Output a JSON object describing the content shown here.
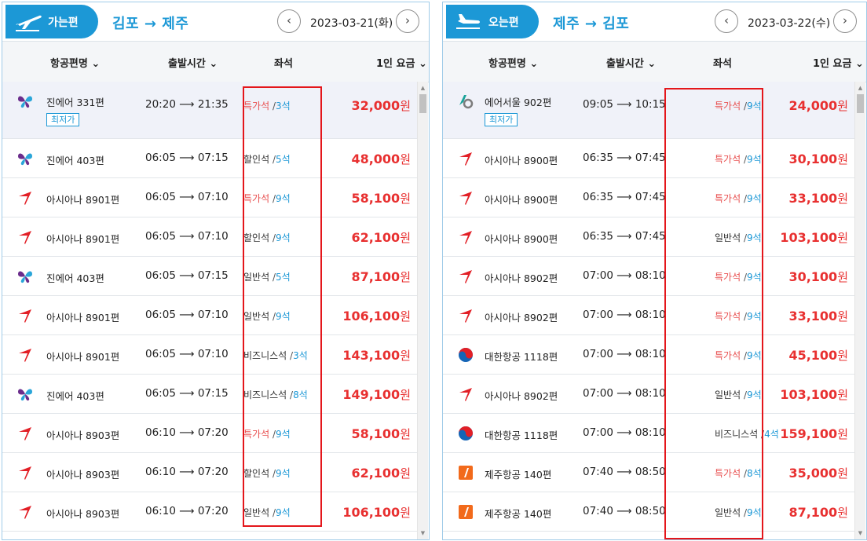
{
  "outbound": {
    "label": "가는편",
    "route": "김포 → 제주",
    "date": "2023-03-21(화)",
    "prev_btn": "‹",
    "next_btn": "›",
    "headers": {
      "airline": "항공편명 ⌄",
      "departure": "출발시간 ⌄",
      "seat": "좌석",
      "fare": "1인 요금 ⌄"
    },
    "flights": [
      {
        "logo": "jinair-butterfly-icon",
        "flight": "진에어 331편",
        "badge": "최저가",
        "dep": "20:20",
        "arr": "21:35",
        "class": "특가석",
        "seats": "3석",
        "price": "32,000",
        "unit": "원"
      },
      {
        "logo": "jinair-butterfly-icon",
        "flight": "진에어 403편",
        "dep": "06:05",
        "arr": "07:15",
        "class": "할인석",
        "seats": "5석",
        "price": "48,000",
        "unit": "원"
      },
      {
        "logo": "asiana-wing-icon",
        "flight": "아시아나 8901편",
        "dep": "06:05",
        "arr": "07:10",
        "class": "특가석",
        "seats": "9석",
        "price": "58,100",
        "unit": "원"
      },
      {
        "logo": "asiana-wing-icon",
        "flight": "아시아나 8901편",
        "dep": "06:05",
        "arr": "07:10",
        "class": "할인석",
        "seats": "9석",
        "price": "62,100",
        "unit": "원"
      },
      {
        "logo": "jinair-butterfly-icon",
        "flight": "진에어 403편",
        "dep": "06:05",
        "arr": "07:15",
        "class": "일반석",
        "seats": "5석",
        "price": "87,100",
        "unit": "원"
      },
      {
        "logo": "asiana-wing-icon",
        "flight": "아시아나 8901편",
        "dep": "06:05",
        "arr": "07:10",
        "class": "일반석",
        "seats": "9석",
        "price": "106,100",
        "unit": "원"
      },
      {
        "logo": "asiana-wing-icon",
        "flight": "아시아나 8901편",
        "dep": "06:05",
        "arr": "07:10",
        "class": "비즈니스석",
        "seats": "3석",
        "price": "143,100",
        "unit": "원"
      },
      {
        "logo": "jinair-butterfly-icon",
        "flight": "진에어 403편",
        "dep": "06:05",
        "arr": "07:15",
        "class": "비즈니스석",
        "seats": "8석",
        "price": "149,100",
        "unit": "원"
      },
      {
        "logo": "asiana-wing-icon",
        "flight": "아시아나 8903편",
        "dep": "06:10",
        "arr": "07:20",
        "class": "특가석",
        "seats": "9석",
        "price": "58,100",
        "unit": "원"
      },
      {
        "logo": "asiana-wing-icon",
        "flight": "아시아나 8903편",
        "dep": "06:10",
        "arr": "07:20",
        "class": "할인석",
        "seats": "9석",
        "price": "62,100",
        "unit": "원"
      },
      {
        "logo": "asiana-wing-icon",
        "flight": "아시아나 8903편",
        "dep": "06:10",
        "arr": "07:20",
        "class": "일반석",
        "seats": "9석",
        "price": "106,100",
        "unit": "원"
      }
    ]
  },
  "inbound": {
    "label": "오는편",
    "route": "제주 → 김포",
    "date": "2023-03-22(수)",
    "prev_btn": "‹",
    "next_btn": "›",
    "headers": {
      "airline": "항공편명 ⌄",
      "departure": "출발시간 ⌄",
      "seat": "좌석",
      "fare": "1인 요금 ⌄"
    },
    "flights": [
      {
        "logo": "airseoul-icon",
        "flight": "에어서울 902편",
        "badge": "최저가",
        "dep": "09:05",
        "arr": "10:15",
        "class": "특가석",
        "seats": "9석",
        "price": "24,000",
        "unit": "원"
      },
      {
        "logo": "asiana-wing-icon",
        "flight": "아시아나 8900편",
        "dep": "06:35",
        "arr": "07:45",
        "class": "특가석",
        "seats": "9석",
        "price": "30,100",
        "unit": "원"
      },
      {
        "logo": "asiana-wing-icon",
        "flight": "아시아나 8900편",
        "dep": "06:35",
        "arr": "07:45",
        "class": "특가석",
        "seats": "9석",
        "price": "33,100",
        "unit": "원"
      },
      {
        "logo": "asiana-wing-icon",
        "flight": "아시아나 8900편",
        "dep": "06:35",
        "arr": "07:45",
        "class": "일반석",
        "seats": "9석",
        "price": "103,100",
        "unit": "원"
      },
      {
        "logo": "asiana-wing-icon",
        "flight": "아시아나 8902편",
        "dep": "07:00",
        "arr": "08:10",
        "class": "특가석",
        "seats": "9석",
        "price": "30,100",
        "unit": "원"
      },
      {
        "logo": "asiana-wing-icon",
        "flight": "아시아나 8902편",
        "dep": "07:00",
        "arr": "08:10",
        "class": "특가석",
        "seats": "9석",
        "price": "33,100",
        "unit": "원"
      },
      {
        "logo": "koreanair-taegeuk-icon",
        "flight": "대한항공 1118편",
        "dep": "07:00",
        "arr": "08:10",
        "class": "특가석",
        "seats": "9석",
        "price": "45,100",
        "unit": "원"
      },
      {
        "logo": "asiana-wing-icon",
        "flight": "아시아나 8902편",
        "dep": "07:00",
        "arr": "08:10",
        "class": "일반석",
        "seats": "9석",
        "price": "103,100",
        "unit": "원"
      },
      {
        "logo": "koreanair-taegeuk-icon",
        "flight": "대한항공 1118편",
        "dep": "07:00",
        "arr": "08:10",
        "class": "비즈니스석",
        "seats": "4석",
        "price": "159,100",
        "unit": "원"
      },
      {
        "logo": "jejuair-icon",
        "flight": "제주항공 140편",
        "dep": "07:40",
        "arr": "08:50",
        "class": "특가석",
        "seats": "8석",
        "price": "35,000",
        "unit": "원"
      },
      {
        "logo": "jejuair-icon",
        "flight": "제주항공 140편",
        "dep": "07:40",
        "arr": "08:50",
        "class": "일반석",
        "seats": "9석",
        "price": "87,100",
        "unit": "원"
      }
    ]
  },
  "colors": {
    "accent": "#1c98d6",
    "price": "#e83030",
    "promo": "#e84e4e",
    "highlight_box": "#e4161b"
  }
}
